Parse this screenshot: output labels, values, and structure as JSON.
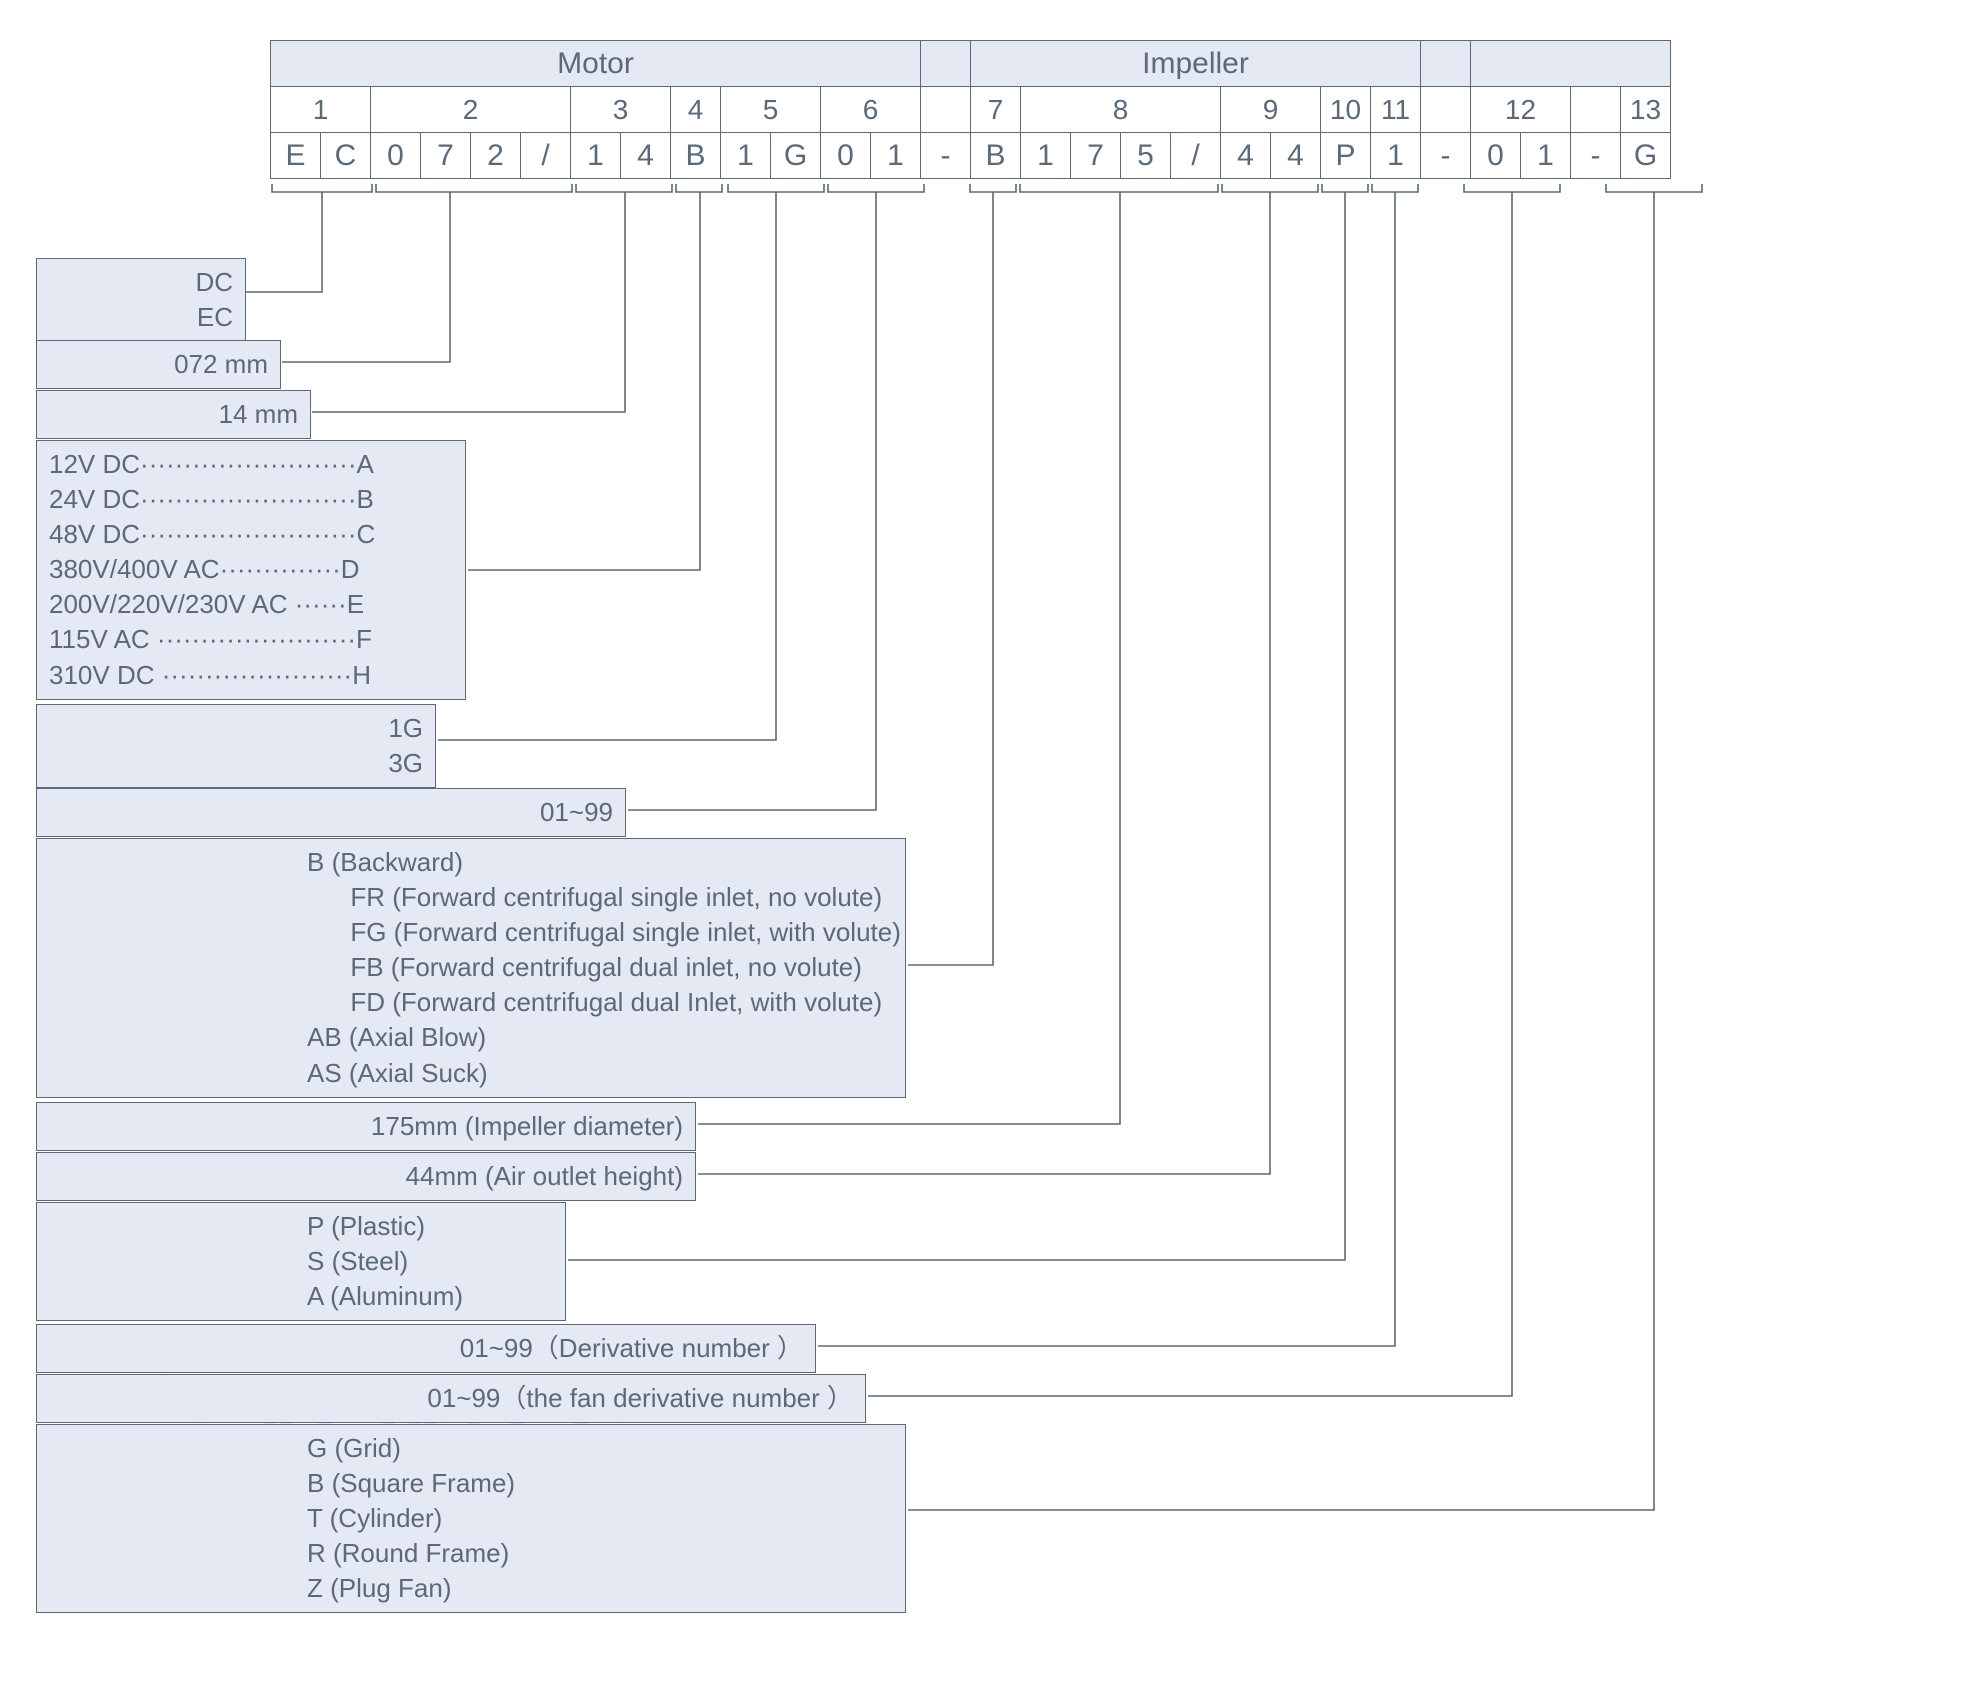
{
  "header": {
    "motor": "Motor",
    "impeller": "Impeller"
  },
  "groups": [
    "1",
    "2",
    "3",
    "4",
    "5",
    "6",
    "7",
    "8",
    "9",
    "10",
    "11",
    "12",
    "13"
  ],
  "chars": [
    "E",
    "C",
    "0",
    "7",
    "2",
    "/",
    "1",
    "4",
    "B",
    "1",
    "G",
    "0",
    "1",
    "-",
    "B",
    "1",
    "7",
    "5",
    "/",
    "4",
    "4",
    "P",
    "1",
    "-",
    "0",
    "1",
    "-",
    "G"
  ],
  "box1": {
    "l1": "DC",
    "l2": "EC"
  },
  "box2": {
    "l1": "072 mm"
  },
  "box3": {
    "l1": "14 mm"
  },
  "box4": {
    "l1": "12V DC·························A",
    "l2": "24V DC·························B",
    "l3": "48V DC·························C",
    "l4": "380V/400V AC··············D",
    "l5": "200V/220V/230V AC ······E",
    "l6": "115V AC ·······················F",
    "l7": "310V DC ······················H"
  },
  "box5": {
    "l1": "1G",
    "l2": "3G"
  },
  "box6": {
    "l1": "01~99"
  },
  "box7": {
    "l1": "B (Backward)",
    "l2": "      FR (Forward centrifugal single inlet, no volute)",
    "l3": "      FG (Forward centrifugal single inlet, with volute)",
    "l4": "      FB (Forward centrifugal dual inlet, no volute)",
    "l5": "      FD (Forward centrifugal dual Inlet, with volute)",
    "l6": "AB (Axial Blow)",
    "l7": "AS (Axial Suck)"
  },
  "box8": {
    "l1": "175mm (Impeller diameter)"
  },
  "box9": {
    "l1": "44mm (Air outlet height)"
  },
  "box10": {
    "l1": "P (Plastic)",
    "l2": "S (Steel)",
    "l3": "A (Aluminum)"
  },
  "box11": {
    "l1": "01~99（Derivative number ）"
  },
  "box12": {
    "l1": "01~99（the fan derivative number ）"
  },
  "box13": {
    "l1": "G (Grid)",
    "l2": "B (Square Frame)",
    "l3": "T (Cylinder)",
    "l4": "R (Round Frame)",
    "l5": "Z (Plug Fan)"
  }
}
